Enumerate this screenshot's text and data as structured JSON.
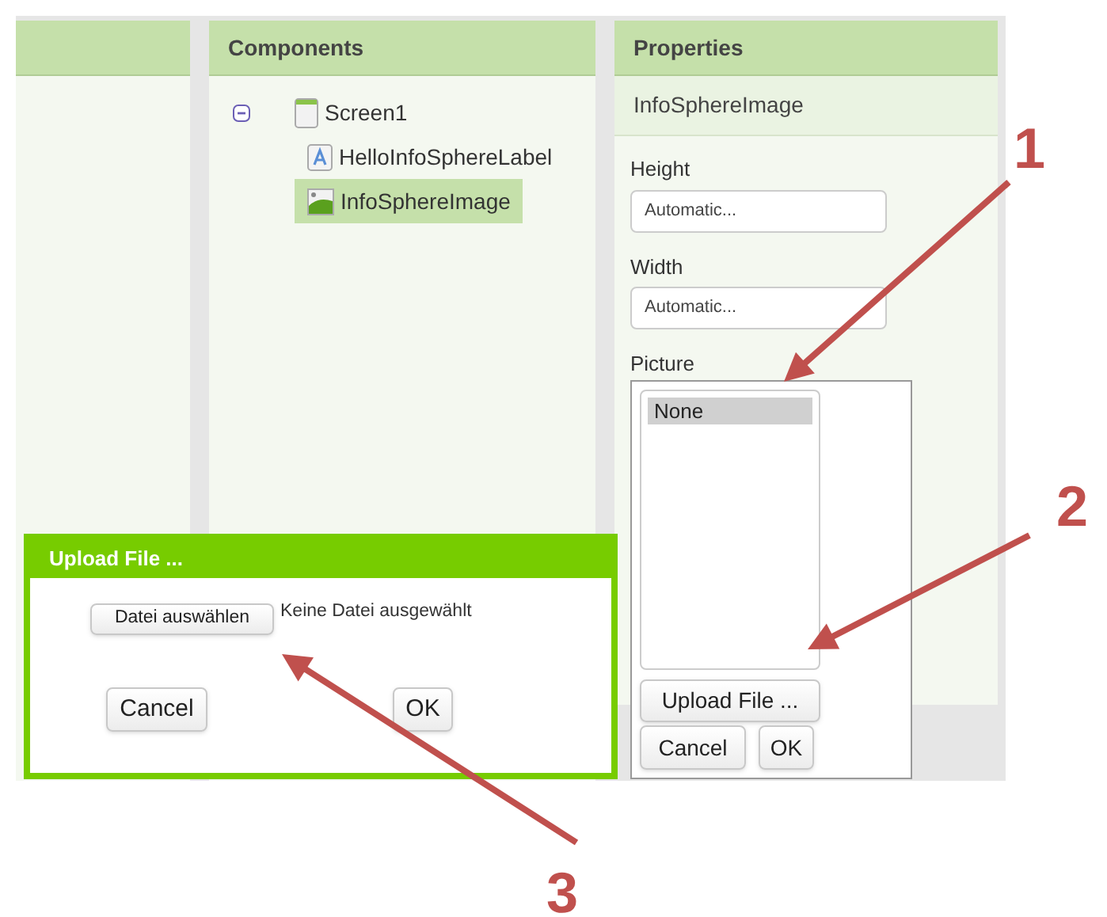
{
  "components_panel": {
    "title": "Components",
    "tree": [
      {
        "label": "Screen1",
        "kind": "screen",
        "expanded": true,
        "selected": false,
        "children": [
          {
            "label": "HelloInfoSphereLabel",
            "kind": "label",
            "selected": false
          },
          {
            "label": "InfoSphereImage",
            "kind": "image",
            "selected": true
          }
        ]
      }
    ]
  },
  "properties_panel": {
    "title": "Properties",
    "component": "InfoSphereImage",
    "fields": [
      {
        "label": "Height",
        "value": "Automatic..."
      },
      {
        "label": "Width",
        "value": "Automatic..."
      }
    ],
    "picture": {
      "label": "Picture",
      "options": [
        {
          "label": "None",
          "selected": true
        }
      ],
      "upload_button": "Upload File ...",
      "cancel_button": "Cancel",
      "ok_button": "OK"
    }
  },
  "upload_dialog": {
    "title": "Upload File ...",
    "choose_button": "Datei auswählen",
    "file_status": "Keine Datei ausgewählt",
    "cancel_button": "Cancel",
    "ok_button": "OK"
  },
  "annotations": [
    {
      "label": "1"
    },
    {
      "label": "2"
    },
    {
      "label": "3"
    }
  ]
}
